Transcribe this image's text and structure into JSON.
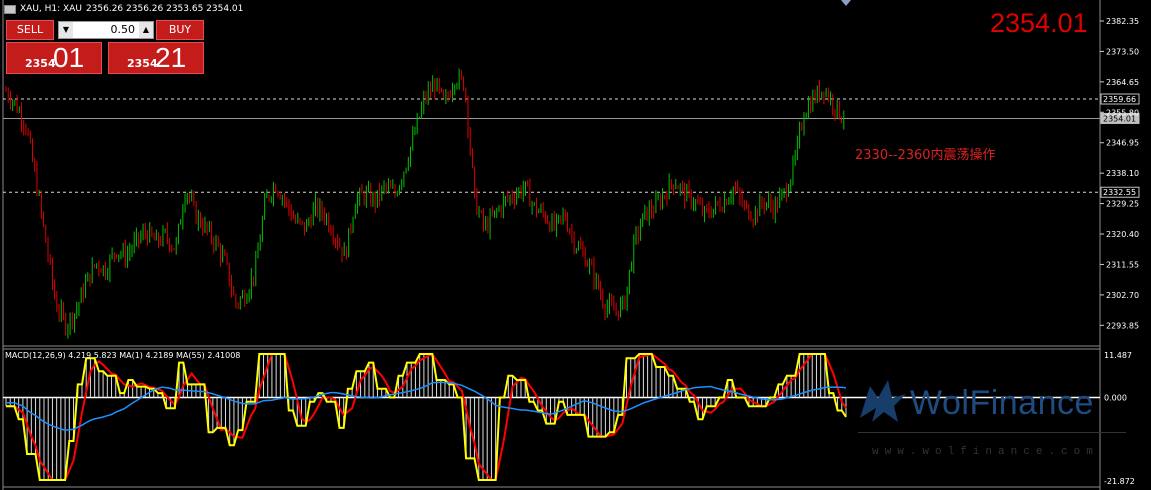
{
  "header": {
    "symbol_info": "XAU, H1:  XAU",
    "ohlc": "2356.26 2356.26 2353.65 2354.01"
  },
  "last_price": "2354.01",
  "trade_panel": {
    "sell_label": "SELL",
    "buy_label": "BUY",
    "lot_value": "0.50",
    "sell_small": "2354",
    "sell_big": "01",
    "buy_small": "2354",
    "buy_big": "21",
    "dec_arrow": "▼",
    "inc_arrow": "▲"
  },
  "price_axis": {
    "ticks": [
      "2382.35",
      "2373.50",
      "2364.65",
      "2355.80",
      "2346.95",
      "2338.10",
      "2329.25",
      "2320.40",
      "2311.55",
      "2302.70",
      "2293.85"
    ],
    "tick_values": [
      2382.35,
      2373.5,
      2364.65,
      2355.8,
      2346.95,
      2338.1,
      2329.25,
      2320.4,
      2311.55,
      2302.7,
      2293.85
    ],
    "marked_levels": [
      {
        "label": "2359.66",
        "value": 2359.66,
        "style": "dotted"
      },
      {
        "label": "2354.01",
        "value": 2354.01,
        "style": "solid"
      },
      {
        "label": "2332.55",
        "value": 2332.55,
        "style": "dotted"
      }
    ]
  },
  "annotation": "2330--2360内震荡操作",
  "macd": {
    "label": "MACD(12,26,9) 4.219 5.823 MA(1) 4.2189 MA(55) 2.41008",
    "axis_top": "11.487",
    "axis_mid": "0.000",
    "axis_bottom": "-21.872",
    "range": [
      -21.872,
      11.487
    ]
  },
  "watermark": {
    "name": "WolFinance",
    "site": "www.wolfinance.com"
  },
  "colors": {
    "bull": "#00c000",
    "bear": "#e00000",
    "macd_fast": "#ffff00",
    "macd_slow": "#ff0000",
    "macd_ma": "#1e90ff",
    "annotation": "#e02020"
  },
  "chart_data": {
    "type": "candlestick",
    "timeframe": "H1",
    "ylim": [
      2289,
      2387
    ],
    "close_path": [
      2362,
      2358,
      2352,
      2336,
      2318,
      2300,
      2294,
      2298,
      2306,
      2312,
      2310,
      2316,
      2314,
      2318,
      2321,
      2318,
      2320,
      2316,
      2334,
      2326,
      2322,
      2318,
      2312,
      2300,
      2303,
      2310,
      2330,
      2335,
      2330,
      2324,
      2322,
      2328,
      2326,
      2320,
      2314,
      2330,
      2332,
      2330,
      2334,
      2332,
      2340,
      2350,
      2360,
      2364,
      2358,
      2366,
      2364,
      2330,
      2322,
      2326,
      2330,
      2332,
      2334,
      2328,
      2326,
      2322,
      2326,
      2318,
      2314,
      2308,
      2300,
      2298,
      2300,
      2318,
      2326,
      2328,
      2332,
      2336,
      2332,
      2330,
      2326,
      2328,
      2330,
      2334,
      2328,
      2326,
      2330,
      2328,
      2332,
      2340,
      2356,
      2360,
      2363,
      2358,
      2354
    ]
  }
}
